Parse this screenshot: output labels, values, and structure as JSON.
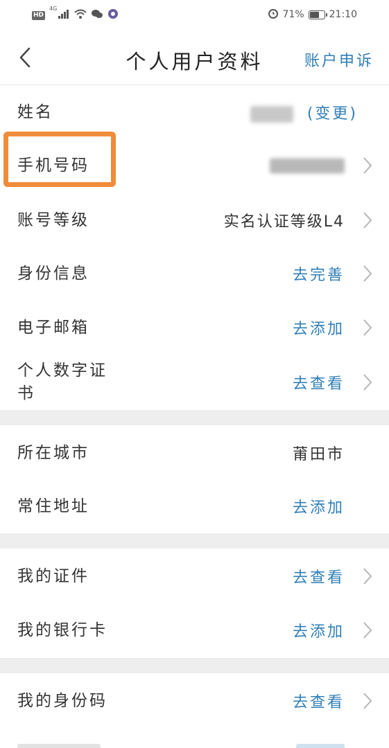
{
  "status_bar": {
    "hd": "HD",
    "network": "4G",
    "battery": "71%",
    "battery_level": 0.71,
    "time": "21:10"
  },
  "nav": {
    "title": "个人用户资料",
    "appeal": "账户申诉",
    "back_icon": "chevron-left-icon"
  },
  "colors": {
    "link": "#2f7fb8",
    "highlight": "#f08c3a",
    "separator": "#eeeeee"
  },
  "rows": {
    "name": {
      "label": "姓名",
      "action": "(变更)"
    },
    "phone": {
      "label": "手机号码"
    },
    "level": {
      "label": "账号等级",
      "value": "实名认证等级L4"
    },
    "identity": {
      "label": "身份信息",
      "value": "去完善"
    },
    "email": {
      "label": "电子邮箱",
      "value": "去添加"
    },
    "cert": {
      "label": "个人数字证书",
      "value": "去查看"
    },
    "city": {
      "label": "所在城市",
      "value": "莆田市"
    },
    "address": {
      "label": "常住地址",
      "value": "去添加"
    },
    "documents": {
      "label": "我的证件",
      "value": "去查看"
    },
    "bankcard": {
      "label": "我的银行卡",
      "value": "去添加"
    },
    "idcode": {
      "label": "我的身份码",
      "value": "去查看"
    }
  }
}
